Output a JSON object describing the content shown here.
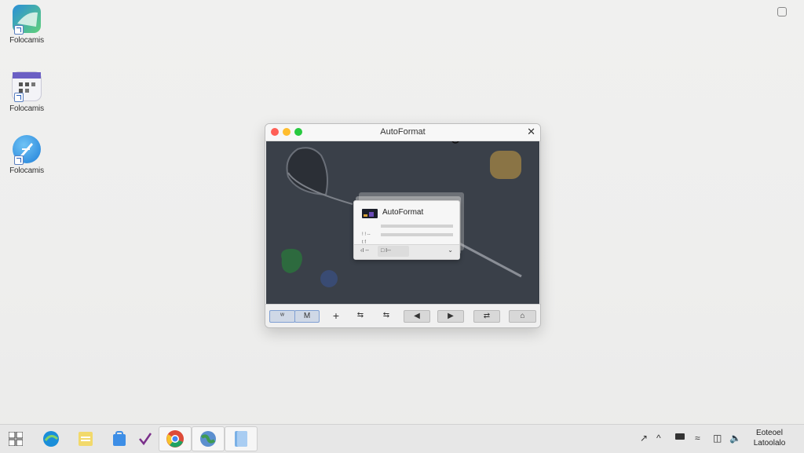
{
  "desktop": {
    "icons": [
      {
        "label": "Folocamis",
        "icon": "paint-app-icon"
      },
      {
        "label": "Folocamis",
        "icon": "calendar-app-icon"
      },
      {
        "label": "Folocamis",
        "icon": "pen-app-icon"
      }
    ]
  },
  "window": {
    "title": "AutoFormat",
    "close_glyph": "✕",
    "dialog": {
      "title": "AutoFormat",
      "rows": [
        "",
        "! ! ‑‑",
        "t f"
      ],
      "footer_left": "‹I ‑‑",
      "footer_mid": "□ I‑‑",
      "footer_arrow": "⌄"
    },
    "toolbar": {
      "b1": "ʷ",
      "b2": "M",
      "add": "+",
      "b4": "⇆",
      "b5": "⇆",
      "prev": "◀",
      "next": "▶",
      "b8": "⇄",
      "b9": "⌂"
    }
  },
  "taskbar": {
    "tray_up_arrow": "^",
    "clock_line1": "Eoteoel",
    "clock_line2": "Latoolalo"
  },
  "colors": {
    "canvas": "#3a4049",
    "accent": "#4c8ad8",
    "window_red": "#ff5f56",
    "window_yellow": "#ffbd2e",
    "window_green": "#27c93f"
  }
}
